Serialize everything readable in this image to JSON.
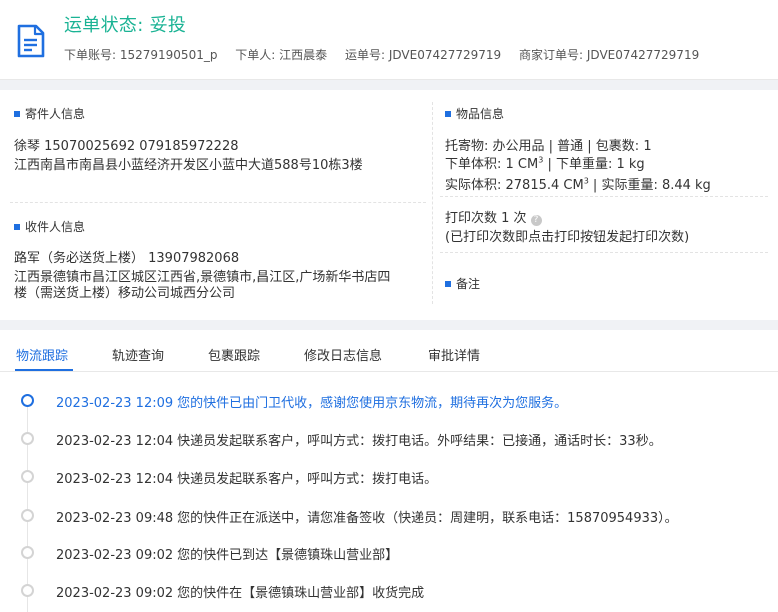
{
  "header": {
    "status_title": "运单状态: 妥投",
    "meta": [
      "下单账号: 15279190501_p",
      "下单人: 江西晨泰",
      "运单号: JDVE07427729719",
      "商家订单号: JDVE07427729719"
    ]
  },
  "sender": {
    "section_label": "寄件人信息",
    "contact": "徐琴    15070025692    079185972228",
    "address": "江西南昌市南昌县小蓝经济开发区小蓝中大道588号10栋3楼"
  },
  "receiver": {
    "section_label": "收件人信息",
    "contact": "路军（务必送货上楼）    13907982068",
    "address_line1": "江西景德镇市昌江区城区江西省,景德镇市,昌江区,广场新华书店四",
    "address_line2": "楼（需送货上楼）移动公司城西分公司"
  },
  "goods": {
    "section_label": "物品信息",
    "line1": "托寄物:  办公用品 | 普通  | 包裹数:  1",
    "order_volume_label": "下单体积:   1 CM",
    "order_volume_sup": "3",
    "order_weight": "  |  下单重量:   1 kg",
    "actual_volume_label": "实际体积:   27815.4 CM",
    "actual_volume_sup": "3",
    "actual_weight": "  |  实际重量:   8.44 kg",
    "print_count": "打印次数    1 次",
    "print_note": "(已打印次数即点击打印按钮发起打印次数)",
    "remark_label": "备注"
  },
  "tabs": [
    "物流跟踪",
    "轨迹查询",
    "包裹跟踪",
    "修改日志信息",
    "审批详情"
  ],
  "timeline": [
    {
      "time": "2023-02-23 12:09",
      "text": "您的快件已由门卫代收，感谢您使用京东物流，期待再次为您服务。"
    },
    {
      "time": "2023-02-23 12:04",
      "text": "快递员发起联系客户，呼叫方式：拨打电话。外呼结果：已接通，通话时长：33秒。"
    },
    {
      "time": "2023-02-23 12:04",
      "text": "快递员发起联系客户，呼叫方式：拨打电话。"
    },
    {
      "time": "2023-02-23 09:48",
      "text": "您的快件正在派送中，请您准备签收（快递员：周建明，联系电话：15870954933）。"
    },
    {
      "time": "2023-02-23 09:02",
      "text": "您的快件已到达【景德镇珠山营业部】"
    },
    {
      "time": "2023-02-23 09:02",
      "text": "您的快件在【景德镇珠山营业部】收货完成"
    }
  ],
  "colors": {
    "accent": "#1f6fe0",
    "status_green": "#1ab394"
  }
}
